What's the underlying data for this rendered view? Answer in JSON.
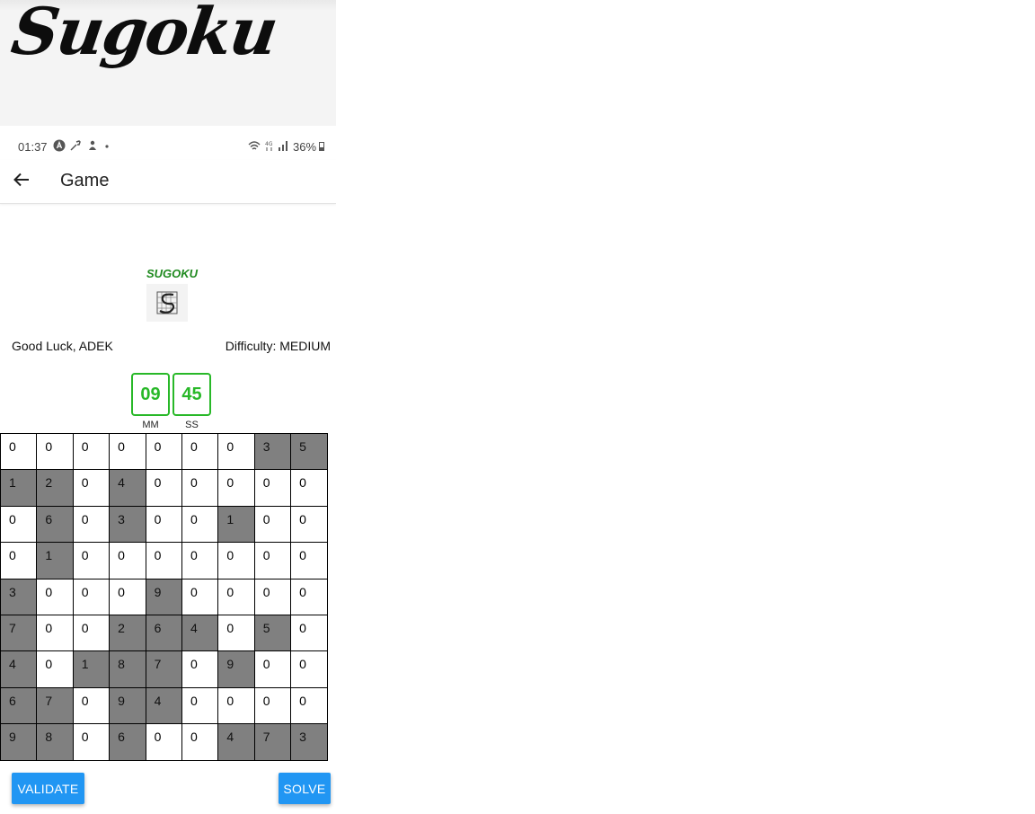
{
  "hero": {
    "title": "Sugoku"
  },
  "status_bar": {
    "time": "01:37",
    "icons": [
      "a-circle-icon",
      "wrench-icon",
      "person-icon",
      "dot-icon",
      "wifi-icon",
      "4g-icon",
      "signal-icon"
    ],
    "battery": "36%"
  },
  "app_bar": {
    "title": "Game",
    "back_icon": "arrow-left-icon"
  },
  "logo": {
    "text": "SUGOKU"
  },
  "info": {
    "greeting": "Good Luck, ADEK",
    "difficulty": "Difficulty: MEDIUM"
  },
  "timer": {
    "minutes": "09",
    "seconds": "45",
    "minutes_label": "MM",
    "seconds_label": "SS"
  },
  "board": {
    "rows": [
      [
        "0",
        "0",
        "0",
        "0",
        "0",
        "0",
        "0",
        "3",
        "5"
      ],
      [
        "1",
        "2",
        "0",
        "4",
        "0",
        "0",
        "0",
        "0",
        "0"
      ],
      [
        "0",
        "6",
        "0",
        "3",
        "0",
        "0",
        "1",
        "0",
        "0"
      ],
      [
        "0",
        "1",
        "0",
        "0",
        "0",
        "0",
        "0",
        "0",
        "0"
      ],
      [
        "3",
        "0",
        "0",
        "0",
        "9",
        "0",
        "0",
        "0",
        "0"
      ],
      [
        "7",
        "0",
        "0",
        "2",
        "6",
        "4",
        "0",
        "5",
        "0"
      ],
      [
        "4",
        "0",
        "1",
        "8",
        "7",
        "0",
        "9",
        "0",
        "0"
      ],
      [
        "6",
        "7",
        "0",
        "9",
        "4",
        "0",
        "0",
        "0",
        "0"
      ],
      [
        "9",
        "8",
        "0",
        "6",
        "0",
        "0",
        "4",
        "7",
        "3"
      ]
    ],
    "given": [
      [
        0,
        0,
        0,
        0,
        0,
        0,
        0,
        1,
        1
      ],
      [
        1,
        1,
        0,
        1,
        0,
        0,
        0,
        0,
        0
      ],
      [
        0,
        1,
        0,
        1,
        0,
        0,
        1,
        0,
        0
      ],
      [
        0,
        1,
        0,
        0,
        0,
        0,
        0,
        0,
        0
      ],
      [
        1,
        0,
        0,
        0,
        1,
        0,
        0,
        0,
        0
      ],
      [
        1,
        0,
        0,
        1,
        1,
        1,
        0,
        1,
        0
      ],
      [
        1,
        0,
        1,
        1,
        1,
        0,
        1,
        0,
        0
      ],
      [
        1,
        1,
        0,
        1,
        1,
        0,
        0,
        0,
        0
      ],
      [
        1,
        1,
        0,
        1,
        0,
        0,
        1,
        1,
        1
      ]
    ]
  },
  "buttons": {
    "validate": "VALIDATE",
    "solve": "SOLVE"
  },
  "colors": {
    "accent": "#2196f3",
    "timer": "#28b828",
    "given_cell": "#808080",
    "logo": "#1f8a1f"
  }
}
